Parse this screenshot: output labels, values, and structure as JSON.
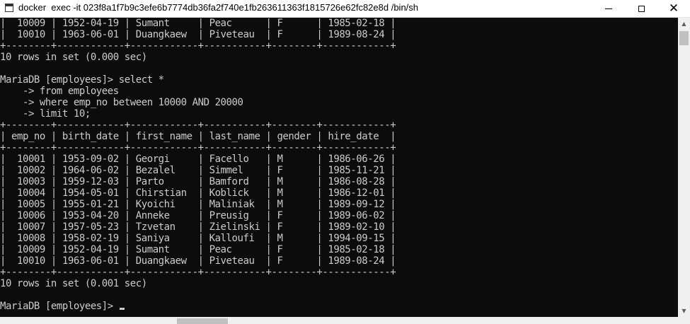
{
  "window": {
    "title": "docker  exec -it 023f8a1f7b9c3efe6b7774db36fa2f740e1fb263611363f1815726e62fc82e8d /bin/sh",
    "minimize_icon": "minimize-icon",
    "maximize_icon": "maximize-icon",
    "close_icon": "close-icon",
    "close_glyph": "✕"
  },
  "terminal": {
    "lines": [
      "|  10009 | 1952-04-19 | Sumant     | Peac      | F      | 1985-02-18 |",
      "|  10010 | 1963-06-01 | Duangkaew  | Piveteau  | F      | 1989-08-24 |",
      "+--------+------------+------------+-----------+--------+------------+",
      "10 rows in set (0.000 sec)",
      "",
      "MariaDB [employees]> select *",
      "    -> from employees",
      "    -> where emp_no between 10000 AND 20000",
      "    -> limit 10;",
      "+--------+------------+------------+-----------+--------+------------+",
      "| emp_no | birth_date | first_name | last_name | gender | hire_date  |",
      "+--------+------------+------------+-----------+--------+------------+",
      "|  10001 | 1953-09-02 | Georgi     | Facello   | M      | 1986-06-26 |",
      "|  10002 | 1964-06-02 | Bezalel    | Simmel    | F      | 1985-11-21 |",
      "|  10003 | 1959-12-03 | Parto      | Bamford   | M      | 1986-08-28 |",
      "|  10004 | 1954-05-01 | Chirstian  | Koblick   | M      | 1986-12-01 |",
      "|  10005 | 1955-01-21 | Kyoichi    | Maliniak  | M      | 1989-09-12 |",
      "|  10006 | 1953-04-20 | Anneke     | Preusig   | F      | 1989-06-02 |",
      "|  10007 | 1957-05-23 | Tzvetan    | Zielinski | F      | 1989-02-10 |",
      "|  10008 | 1958-02-19 | Saniya     | Kalloufi  | M      | 1994-09-15 |",
      "|  10009 | 1952-04-19 | Sumant     | Peac      | F      | 1985-02-18 |",
      "|  10010 | 1963-06-01 | Duangkaew  | Piveteau  | F      | 1989-08-24 |",
      "+--------+------------+------------+-----------+--------+------------+",
      "10 rows in set (0.001 sec)",
      "",
      "MariaDB [employees]> "
    ],
    "cursor": "underscore",
    "colors": {
      "background": "#0c0c0c",
      "foreground": "#cccccc"
    }
  },
  "scrollbars": {
    "up_arrow_icon": "scroll-up-arrow-icon",
    "down_arrow_icon": "scroll-down-arrow-icon",
    "up_glyph": "▲",
    "down_glyph": "▼"
  }
}
